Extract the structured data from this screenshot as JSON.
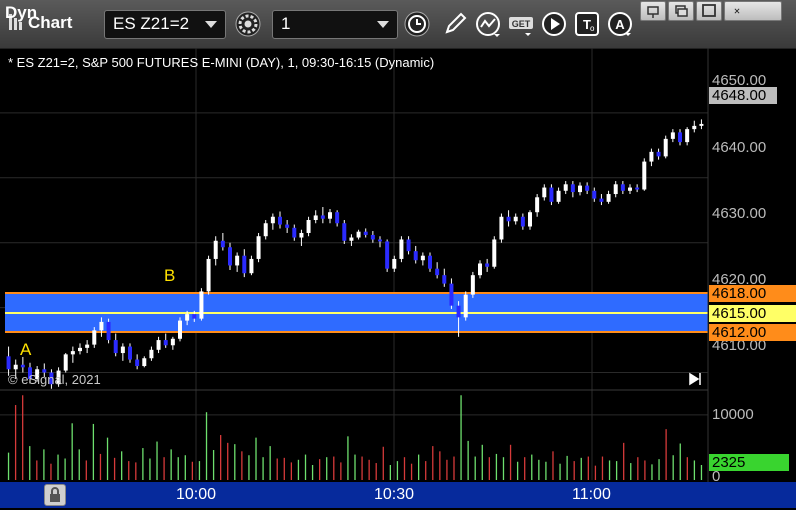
{
  "window": {
    "title": "Chart",
    "symbol": "ES Z21=2",
    "interval": "1",
    "icons": [
      "gear-icon",
      "clock-icon",
      "pencil-icon",
      "curve-icon",
      "get-icon",
      "play-icon",
      "text-icon",
      "alert-icon"
    ],
    "window_buttons": [
      "pin-icon",
      "restore-icon",
      "maximize-icon",
      "close-icon"
    ]
  },
  "chart": {
    "info": "* ES Z21=2, S&P 500 FUTURES E-MINI (DAY), 1, 09:30-16:15 (Dynamic)",
    "copyright": "© eSignal, 2021",
    "annotations": {
      "a": "A",
      "b": "B"
    },
    "price_axis": [
      "4650.00",
      "4640.00",
      "4630.00",
      "4620.00",
      "4610.00"
    ],
    "tags": {
      "last": "4648.00",
      "high": "4618.00",
      "mid": "4615.00",
      "low": "4612.00"
    },
    "volume_axis": [
      "10000",
      "0"
    ],
    "volume_tag": "2325",
    "time_axis": [
      "10:00",
      "10:30",
      "11:00"
    ],
    "bottom_label": "Dyn",
    "colors": {
      "up_candle": "#ffffff",
      "down_candle": "#2b2bff",
      "zone": "#2f6bff",
      "zone_edge": "#ff8c1a",
      "mid_line": "#ffff66",
      "grid": "#2a2a2a",
      "vol_up": "#6ee06e",
      "vol_down": "#d63a3a"
    }
  },
  "chart_data": {
    "type": "candlestick",
    "title": "ES Z21=2, S&P 500 FUTURES E-MINI (DAY), 1, 09:30-16:15 (Dynamic)",
    "ylim": [
      4607,
      4660
    ],
    "x": [
      "10:00",
      "10:30",
      "11:00"
    ],
    "levels": {
      "zone_top": 4618,
      "zone_mid": 4615,
      "zone_bottom": 4612,
      "last": 4648
    },
    "candles": [
      [
        4612.5,
        4614,
        4609.5,
        4610.5
      ],
      [
        4610.5,
        4612,
        4609,
        4611.2
      ],
      [
        4611.2,
        4612.4,
        4610,
        4610.8
      ],
      [
        4610.8,
        4611.5,
        4608.3,
        4609
      ],
      [
        4609,
        4611,
        4608.6,
        4610.5
      ],
      [
        4610.5,
        4611.4,
        4609.3,
        4610
      ],
      [
        4610,
        4610.5,
        4607.5,
        4608.2
      ],
      [
        4608.2,
        4610.8,
        4607.8,
        4610.3
      ],
      [
        4610.3,
        4613,
        4610,
        4612.8
      ],
      [
        4612.8,
        4614,
        4611.5,
        4613.3
      ],
      [
        4613.3,
        4614.5,
        4612.8,
        4613.8
      ],
      [
        4613.8,
        4615,
        4613,
        4614.3
      ],
      [
        4614.3,
        4617,
        4613.8,
        4616.5
      ],
      [
        4616.5,
        4618.5,
        4615.5,
        4617.8
      ],
      [
        4617.8,
        4618.3,
        4614.5,
        4615
      ],
      [
        4615,
        4616,
        4612.5,
        4613
      ],
      [
        4613,
        4614.5,
        4611.8,
        4614
      ],
      [
        4614,
        4614.5,
        4611.5,
        4612
      ],
      [
        4612,
        4612.8,
        4610.5,
        4611
      ],
      [
        4611,
        4612.5,
        4610.8,
        4612.2
      ],
      [
        4612.2,
        4614,
        4611.8,
        4613.5
      ],
      [
        4613.5,
        4615.5,
        4613,
        4615
      ],
      [
        4615,
        4616,
        4613.8,
        4614.2
      ],
      [
        4614.2,
        4615.5,
        4613.5,
        4615.2
      ],
      [
        4615.2,
        4618.5,
        4614.8,
        4618
      ],
      [
        4618,
        4619.5,
        4617.3,
        4619
      ],
      [
        4619,
        4619.5,
        4617.8,
        4618.3
      ],
      [
        4618.3,
        4623,
        4618,
        4622.5
      ],
      [
        4622.5,
        4628,
        4622,
        4627.5
      ],
      [
        4627.5,
        4631,
        4626.5,
        4630.3
      ],
      [
        4630.3,
        4631.5,
        4628.8,
        4629.3
      ],
      [
        4629.3,
        4630,
        4625.8,
        4626.5
      ],
      [
        4626.5,
        4628.5,
        4625.5,
        4628
      ],
      [
        4628,
        4629,
        4624.7,
        4625.3
      ],
      [
        4625.3,
        4628,
        4625,
        4627.5
      ],
      [
        4627.5,
        4631.5,
        4627,
        4631
      ],
      [
        4631,
        4633.5,
        4630.5,
        4633
      ],
      [
        4633,
        4634.5,
        4632,
        4634
      ],
      [
        4634,
        4634.8,
        4632.2,
        4632.8
      ],
      [
        4632.8,
        4633.5,
        4631.5,
        4632.3
      ],
      [
        4632.3,
        4632.8,
        4630.3,
        4630.8
      ],
      [
        4630.8,
        4632,
        4629.5,
        4631.5
      ],
      [
        4631.5,
        4634,
        4631,
        4633.5
      ],
      [
        4633.5,
        4635,
        4633,
        4634.2
      ],
      [
        4634.2,
        4635.5,
        4633,
        4633.7
      ],
      [
        4633.7,
        4635.2,
        4633,
        4634.7
      ],
      [
        4634.7,
        4635,
        4632.5,
        4633
      ],
      [
        4633,
        4633.5,
        4629.8,
        4630.3
      ],
      [
        4630.3,
        4631.3,
        4629.5,
        4630.8
      ],
      [
        4630.8,
        4632,
        4630.5,
        4631.7
      ],
      [
        4631.7,
        4632.2,
        4630.8,
        4631.2
      ],
      [
        4631.2,
        4631.8,
        4630,
        4630.5
      ],
      [
        4630.5,
        4631,
        4629.3,
        4630.2
      ],
      [
        4630.2,
        4630.5,
        4625.5,
        4626
      ],
      [
        4626,
        4628,
        4625.5,
        4627.5
      ],
      [
        4627.5,
        4631,
        4627,
        4630.5
      ],
      [
        4630.5,
        4631,
        4628.2,
        4628.7
      ],
      [
        4628.7,
        4629.5,
        4626.8,
        4627.3
      ],
      [
        4627.3,
        4628.5,
        4626.5,
        4628
      ],
      [
        4628,
        4628.5,
        4625.5,
        4626
      ],
      [
        4626,
        4627,
        4624.5,
        4625
      ],
      [
        4625,
        4626,
        4623.2,
        4623.7
      ],
      [
        4623.7,
        4624.5,
        4619.8,
        4620.3
      ],
      [
        4620.3,
        4621,
        4615.5,
        4618.5
      ],
      [
        4618.5,
        4622.5,
        4618,
        4622
      ],
      [
        4622,
        4625.5,
        4621.5,
        4625
      ],
      [
        4625,
        4627.3,
        4624.5,
        4626.8
      ],
      [
        4626.8,
        4627.5,
        4625.5,
        4626.3
      ],
      [
        4626.3,
        4631,
        4626,
        4630.5
      ],
      [
        4630.5,
        4634.5,
        4630,
        4634
      ],
      [
        4634,
        4635,
        4632.5,
        4633.3
      ],
      [
        4633.3,
        4634.5,
        4632.8,
        4634
      ],
      [
        4634,
        4634.5,
        4632,
        4632.5
      ],
      [
        4632.5,
        4635,
        4632,
        4634.7
      ],
      [
        4634.7,
        4637.5,
        4634,
        4637
      ],
      [
        4637,
        4639,
        4636.5,
        4638.5
      ],
      [
        4638.5,
        4639,
        4635.8,
        4636.3
      ],
      [
        4636.3,
        4638.5,
        4636,
        4638
      ],
      [
        4638,
        4639.5,
        4637.5,
        4639
      ],
      [
        4639,
        4639.5,
        4637,
        4637.8
      ],
      [
        4637.8,
        4639.3,
        4637.3,
        4638.8
      ],
      [
        4638.8,
        4639.3,
        4637.5,
        4638
      ],
      [
        4638,
        4638.5,
        4636.3,
        4636.8
      ],
      [
        4636.8,
        4637.5,
        4635.8,
        4636.3
      ],
      [
        4636.3,
        4638,
        4636,
        4637.5
      ],
      [
        4637.5,
        4639.5,
        4637,
        4639
      ],
      [
        4639,
        4639.5,
        4637.5,
        4638
      ],
      [
        4638,
        4639,
        4637.5,
        4638.5
      ],
      [
        4638.5,
        4639,
        4637.8,
        4638.2
      ],
      [
        4638.2,
        4643,
        4638,
        4642.5
      ],
      [
        4642.5,
        4644.5,
        4641.8,
        4644
      ],
      [
        4644,
        4644.5,
        4642.8,
        4643.3
      ],
      [
        4643.3,
        4646.5,
        4643,
        4646
      ],
      [
        4646,
        4647.5,
        4645.5,
        4647
      ],
      [
        4647,
        4647.5,
        4645,
        4645.5
      ],
      [
        4645.5,
        4647.8,
        4645,
        4647.5
      ],
      [
        4647.5,
        4648.8,
        4647,
        4648
      ],
      [
        4648,
        4649,
        4647.5,
        4648.3
      ]
    ],
    "volume": {
      "ylim": [
        0,
        13500
      ],
      "last": 2325,
      "values": [
        4200,
        11500,
        13000,
        5200,
        3000,
        4700,
        2500,
        3900,
        3300,
        8700,
        4700,
        3000,
        8600,
        4000,
        6500,
        3400,
        4400,
        2900,
        2700,
        4900,
        3300,
        5900,
        3500,
        4700,
        3500,
        3800,
        2800,
        2900,
        10400,
        4600,
        6900,
        5700,
        5500,
        4400,
        3800,
        6500,
        3500,
        5200,
        3300,
        3400,
        2700,
        3100,
        3900,
        2300,
        3200,
        3500,
        3600,
        2700,
        6700,
        3900,
        3600,
        3100,
        2600,
        5100,
        2300,
        2900,
        3500,
        2500,
        3900,
        2900,
        5200,
        4400,
        3100,
        3600,
        13000,
        6000,
        3600,
        5400,
        3500,
        4000,
        3500,
        5400,
        2800,
        3500,
        3900,
        3100,
        2800,
        4400,
        2500,
        3700,
        2900,
        3400,
        3600,
        2200,
        3600,
        3000,
        2900,
        5700,
        2600,
        3500,
        3000,
        2400,
        3200,
        7800,
        3800,
        5600,
        3500,
        3000,
        2300
      ],
      "up": [
        true,
        false,
        false,
        true,
        false,
        true,
        false,
        true,
        true,
        true,
        true,
        false,
        true,
        false,
        true,
        false,
        true,
        false,
        false,
        true,
        true,
        true,
        false,
        true,
        true,
        true,
        false,
        true,
        true,
        true,
        false,
        false,
        true,
        false,
        true,
        true,
        true,
        true,
        false,
        false,
        false,
        true,
        true,
        true,
        false,
        true,
        false,
        false,
        true,
        true,
        false,
        false,
        false,
        false,
        true,
        true,
        false,
        false,
        true,
        false,
        false,
        false,
        false,
        false,
        true,
        true,
        true,
        true,
        false,
        true,
        true,
        false,
        true,
        false,
        true,
        true,
        true,
        false,
        true,
        true,
        false,
        true,
        false,
        false,
        false,
        true,
        true,
        false,
        true,
        false,
        false,
        true,
        true,
        false,
        true,
        true,
        false,
        true,
        true
      ]
    }
  }
}
